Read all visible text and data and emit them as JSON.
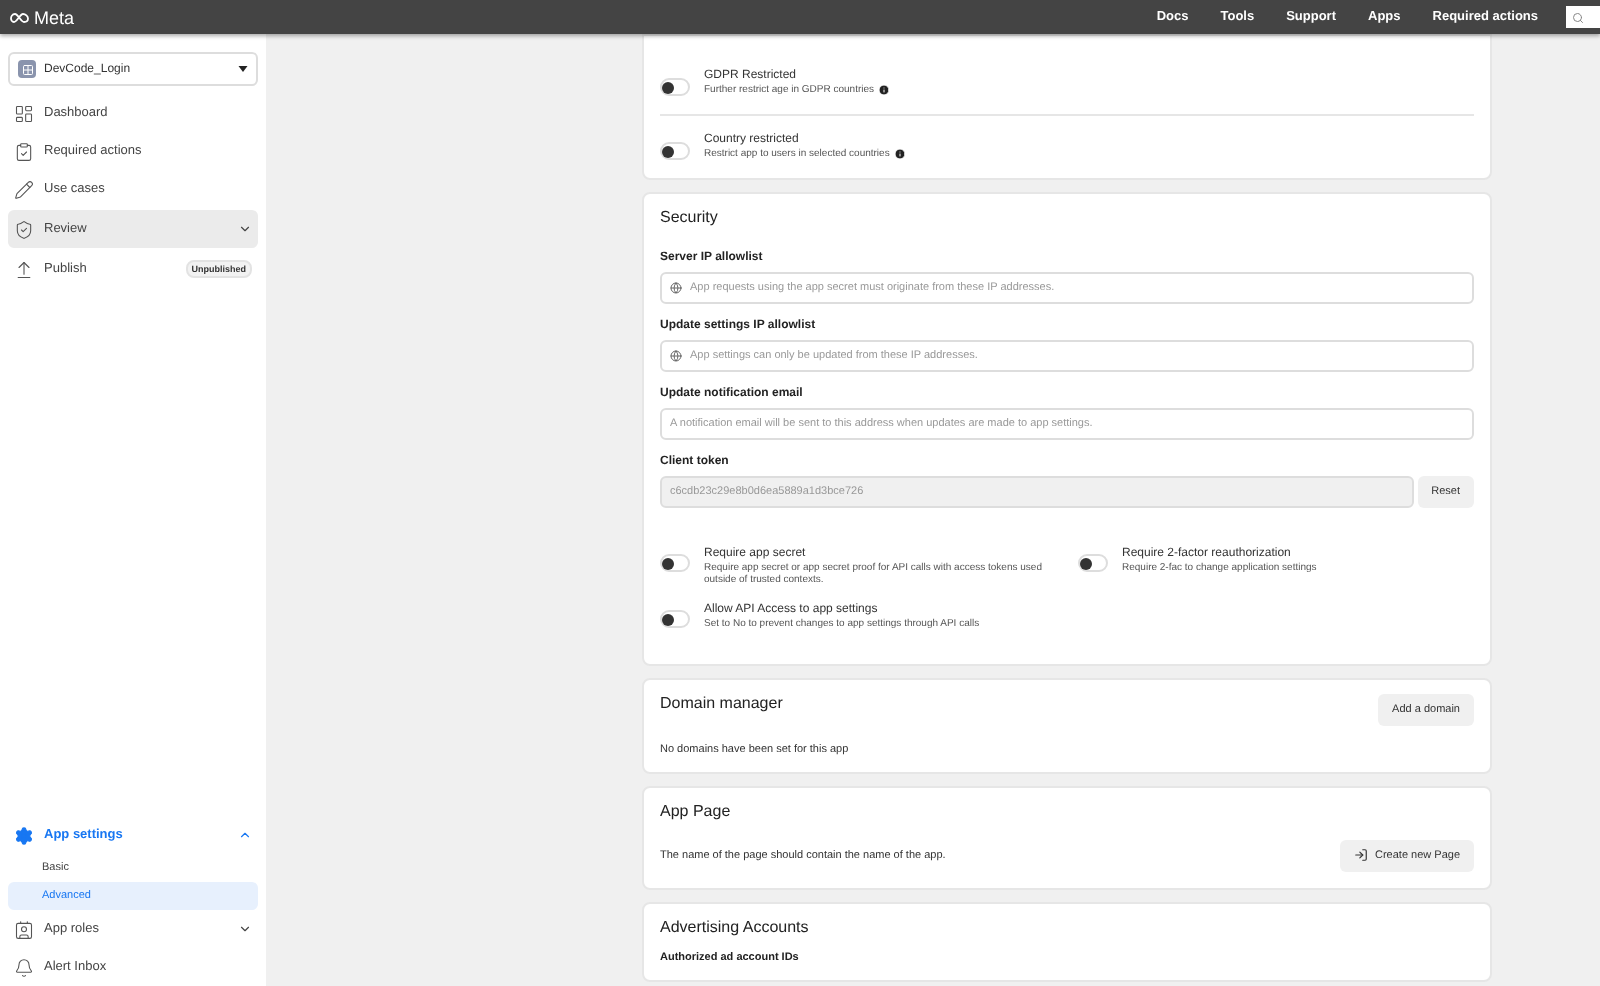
{
  "topbar": {
    "logo": "Meta",
    "nav": [
      "Docs",
      "Tools",
      "Support",
      "Apps",
      "Required actions"
    ]
  },
  "sidebar": {
    "app_selector": "DevCode_Login",
    "nav_top": [
      {
        "label": "Dashboard",
        "selected": false
      },
      {
        "label": "Required actions",
        "selected": false
      },
      {
        "label": "Use cases",
        "selected": false
      },
      {
        "label": "Review",
        "selected": true,
        "expanded": false
      },
      {
        "label": "Publish",
        "selected": false,
        "badge": "Unpublished"
      }
    ],
    "nav_bottom": [
      {
        "label": "App settings",
        "selected": true,
        "expanded": true,
        "children": [
          {
            "label": "Basic",
            "selected": false
          },
          {
            "label": "Advanced",
            "selected": true
          }
        ]
      },
      {
        "label": "App roles",
        "selected": false,
        "expanded": false
      },
      {
        "label": "Alert Inbox",
        "selected": false
      }
    ]
  },
  "restrictions": [
    {
      "title": "GDPR Restricted",
      "description": "Further restrict age in GDPR countries",
      "on": false
    },
    {
      "title": "Country restricted",
      "description": "Restrict app to users in selected countries",
      "on": false
    }
  ],
  "security": {
    "title": "Security",
    "fields": [
      {
        "kind": "ip",
        "label": "Server IP allowlist",
        "placeholder": "App requests using the app secret must originate from these IP addresses."
      },
      {
        "kind": "ip",
        "label": "Update settings IP allowlist",
        "placeholder": "App settings can only be updated from these IP addresses."
      },
      {
        "kind": "email",
        "label": "Update notification email",
        "placeholder": "A notification email will be sent to this address when updates are made to app settings."
      }
    ],
    "client_token": {
      "label": "Client token",
      "value": "c6cdb23c29e8b0d6ea5889a1d3bce726",
      "disabled": true,
      "button": "Reset"
    },
    "toggles": [
      {
        "title": "Require app secret",
        "description": "Require app secret or app secret proof for API calls with access tokens used outside of trusted contexts.",
        "on": false
      },
      {
        "title": "Require 2-factor reauthorization",
        "description": "Require 2-fac to change application settings",
        "on": false
      },
      {
        "title": "Allow API Access to app settings",
        "description": "Set to No to prevent changes to app settings through API calls",
        "on": false
      }
    ]
  },
  "domain_manager": {
    "title": "Domain manager",
    "button": "Add a domain",
    "text": "No domains have been set for this app"
  },
  "app_page": {
    "title": "App Page",
    "text": "The name of the page should contain the name of the app.",
    "button": "Create new Page"
  },
  "advertising": {
    "title": "Advertising Accounts",
    "label": "Authorized ad account IDs"
  }
}
